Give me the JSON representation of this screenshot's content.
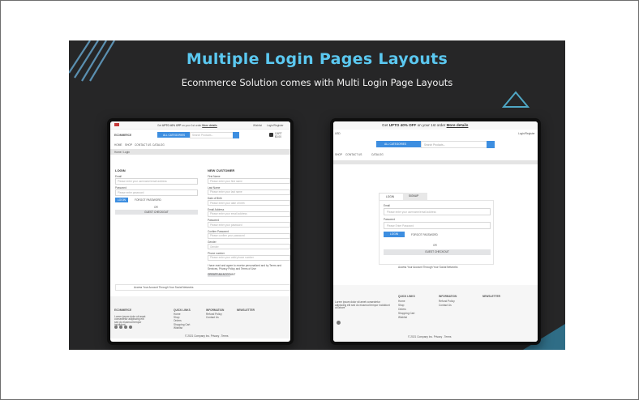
{
  "banner": {
    "title": "Multiple Login Pages Layouts",
    "subtitle": "Ecommerce Solution comes with Multi Login Page Layouts",
    "colors": {
      "background": "#262627",
      "title": "#5bc8f0",
      "accent": "#3d8ee0"
    }
  },
  "left_screen": {
    "promo": {
      "prefix": "Get ",
      "highlight": "UPTO 40% OFF",
      "suffix": " on your 1st order",
      "link": "More details"
    },
    "top_links": [
      "Wishlist",
      "Login/Register"
    ],
    "brand": "ECOMMERCE",
    "category_select": "ALL CATEGORIES",
    "search_placeholder": "Search Products...",
    "cart": {
      "label": "CART",
      "amount": "$0.00"
    },
    "nav": [
      "HOME",
      "SHOP",
      "CONTACT US",
      "CATALOG"
    ],
    "breadcrumb": "Home / Login",
    "login": {
      "heading": "LOGIN",
      "email_label": "Email",
      "email_placeholder": "Please enter your username/email address",
      "password_label": "Password",
      "password_placeholder": "Please enter password",
      "login_button": "LOGIN",
      "forgot": "FORGOT PASSWORD",
      "or": "OR",
      "guest_button": "GUEST CHECKOUT"
    },
    "register": {
      "heading": "NEW CUSTOMER",
      "fields": [
        {
          "label": "First Name",
          "placeholder": "Please enter your first name"
        },
        {
          "label": "Last Name",
          "placeholder": "Please enter your last name"
        },
        {
          "label": "Date of Birth",
          "placeholder": "Please enter your date of birth"
        },
        {
          "label": "Email Address",
          "placeholder": "Please enter your email address"
        },
        {
          "label": "Password",
          "placeholder": "Please enter your password"
        },
        {
          "label": "Confirm Password",
          "placeholder": "Please confirm your password"
        },
        {
          "label": "Gender",
          "placeholder": "Gender"
        },
        {
          "label": "Phone number",
          "placeholder": "Please enter your valid phone number"
        }
      ],
      "consent": "I have read and agree to receive personalized and by Terms and Services, Privacy Policy and Terms of Use",
      "create_button": "CREATE AN ACCOUNT"
    },
    "social_note": "Access Your Account Through Your Social Networks",
    "footer": {
      "brand": "ECOMMERCE",
      "address": "Lorem ipsum dolor sit amet consectetur adipiscing elit sed do eiusmod tempor incididunt",
      "quick_links_title": "QUICK LINKS",
      "quick_links": [
        "Home",
        "Shop",
        "Orders",
        "Shopping Cart",
        "Wishlist"
      ],
      "info_title": "INFORMATION",
      "info_links": [
        "Refund Policy",
        "Contact Us"
      ],
      "newsletter_title": "NEWSLETTER",
      "copyright": "© 2021 Company Inc. Privacy . Terms"
    }
  },
  "right_screen": {
    "promo": {
      "prefix": "Get ",
      "highlight": "UPTO 40% OFF",
      "suffix": " on your 1st order",
      "link": "More details"
    },
    "lang": "USD",
    "top_link": "Login/Register",
    "category_select": "ALL CATEGORIES",
    "search_placeholder": "Search Products...",
    "nav": [
      "SHOP",
      "CONTACT US",
      "CATALOG"
    ],
    "tabs": [
      "LOGIN",
      "SIGNUP"
    ],
    "login": {
      "email_label": "Email",
      "email_placeholder": "Please enter your username/email address",
      "password_label": "Password",
      "password_placeholder": "Please Enter Password",
      "login_button": "LOGIN",
      "forgot": "FORGOT PASSWORD",
      "or": "OR",
      "guest_button": "GUEST CHECKOUT"
    },
    "social_note": "Access Your Account Through Your Social Networks",
    "footer": {
      "address": "Lorem ipsum dolor sit amet consectetur adipiscing elit sed do eiusmod tempor incididunt ut labore",
      "quick_links_title": "QUICK LINKS",
      "quick_links": [
        "Home",
        "Shop",
        "Orders",
        "Shopping Cart",
        "Wishlist"
      ],
      "info_title": "INFORMATION",
      "info_links": [
        "Refund Policy",
        "Contact Us"
      ],
      "newsletter_title": "NEWSLETTER",
      "copyright": "© 2021 Company Inc. Privacy . Terms"
    }
  }
}
